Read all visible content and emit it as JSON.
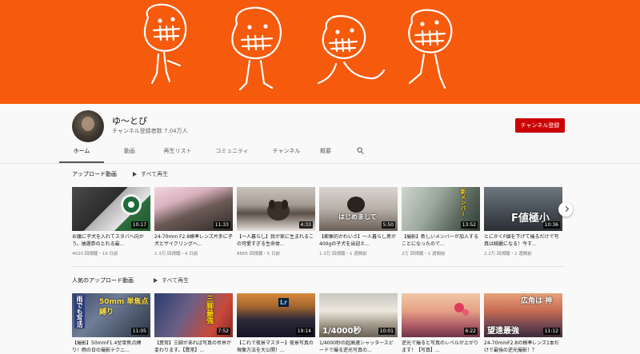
{
  "channel": {
    "name": "ゆ〜とぴ",
    "subscribers": "チャンネル登録者数 7.04万人",
    "subscribe_label": "チャンネル登録",
    "brand_color": "#f65a0c",
    "subscribe_color": "#cc0000"
  },
  "tabs": [
    "ホーム",
    "動画",
    "再生リスト",
    "コミュニティ",
    "チャンネル",
    "概要"
  ],
  "sections": [
    {
      "title": "アップロード動画",
      "play_all": "すべて再生",
      "videos": [
        {
          "title": "お腹に子犬を入れてスタバへ向かう。抽選券のとれる最...",
          "meta": "4020 回視聴・19 日前",
          "duration": "10:17"
        },
        {
          "title": "24-70mm F2.8標準レンズ片手に子犬とサイクリングへ...",
          "meta": "1.3万 回視聴・4 日前",
          "duration": "11:33"
        },
        {
          "title": "【一人暮らし】我が家に生まれるこの可愛すぎる生命体...",
          "meta": "8665 回視聴・5 日前",
          "duration": "4:33"
        },
        {
          "title": "【衝撃的かわいさ】一人暮らし男が400gの子犬を出迎え...",
          "meta": "1.3万 回視聴・1 週間前",
          "duration": "5:50"
        },
        {
          "title": "【撮影】新しいメンバーが加入することになったので...",
          "meta": "2万 回視聴・1 週間前",
          "duration": "13:52"
        },
        {
          "title": "とにかくF値を下げて撮るだけで写真は綺麗になる！今す...",
          "meta": "2.2万 回視聴・2 週間前",
          "duration": "10:36"
        }
      ]
    },
    {
      "title": "人気のアップロード動画",
      "play_all": "すべて再生",
      "videos": [
        {
          "title": "【撮影】50mmF1.4型単焦点縛り！雨の日の撮影テクニ...",
          "duration": "11:05"
        },
        {
          "title": "【異常】三脚があれば写真の世界が変わります。【異常】...",
          "duration": "7:52"
        },
        {
          "title": "【これで夜景マスター】夜景写真の現像方法を大公開！...",
          "duration": "19:14"
        },
        {
          "title": "1/4000秒の超高速シャッタースピードで撮る逆光写真の...",
          "duration": "10:01"
        },
        {
          "title": "逆光で撮ると写真のレベルが上がります！【写真】...",
          "duration": "6:22"
        },
        {
          "title": "24-70mmF2.8の標準レンズ1本だけで最強の逆光撮影！？",
          "duration": "11:12"
        }
      ]
    }
  ],
  "thumb_overlays": {
    "t2_4": "はじめまして",
    "t2_5": "新メンバー",
    "t2_6": "F値極小",
    "b_1a": "雨でも写活",
    "b_1b": "50mm 単焦点縛り",
    "b_2": "三脚最強",
    "b_3": "Lr",
    "b_4": "1/4000秒",
    "b_6a": "広角は 神",
    "b_6b": "望遠最強"
  }
}
